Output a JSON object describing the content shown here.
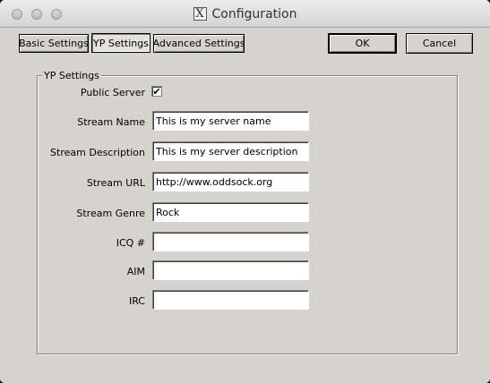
{
  "window": {
    "title": "Configuration",
    "logo_glyph": "X"
  },
  "tabs": [
    {
      "label": "Basic Settings"
    },
    {
      "label": "YP Settings",
      "selected": true
    },
    {
      "label": "Advanced Settings"
    }
  ],
  "buttons": {
    "ok_label": "OK",
    "cancel_label": "Cancel"
  },
  "yp": {
    "group_title": "YP Settings",
    "public_server": {
      "label": "Public Server",
      "checked": true,
      "check_glyph": "✔"
    },
    "fields": [
      {
        "key": "stream_name",
        "label": "Stream Name",
        "value": "This is my server name"
      },
      {
        "key": "stream_description",
        "label": "Stream Description",
        "value": "This is my server description"
      },
      {
        "key": "stream_url",
        "label": "Stream URL",
        "value": "http://www.oddsock.org"
      },
      {
        "key": "stream_genre",
        "label": "Stream Genre",
        "value": "Rock"
      },
      {
        "key": "icq",
        "label": "ICQ #",
        "value": ""
      },
      {
        "key": "aim",
        "label": "AIM",
        "value": ""
      },
      {
        "key": "irc",
        "label": "IRC",
        "value": ""
      }
    ]
  },
  "colors": {
    "window_bg": "#d6d3ce",
    "titlebar_top": "#ececec",
    "titlebar_bottom": "#d4d4d4"
  }
}
